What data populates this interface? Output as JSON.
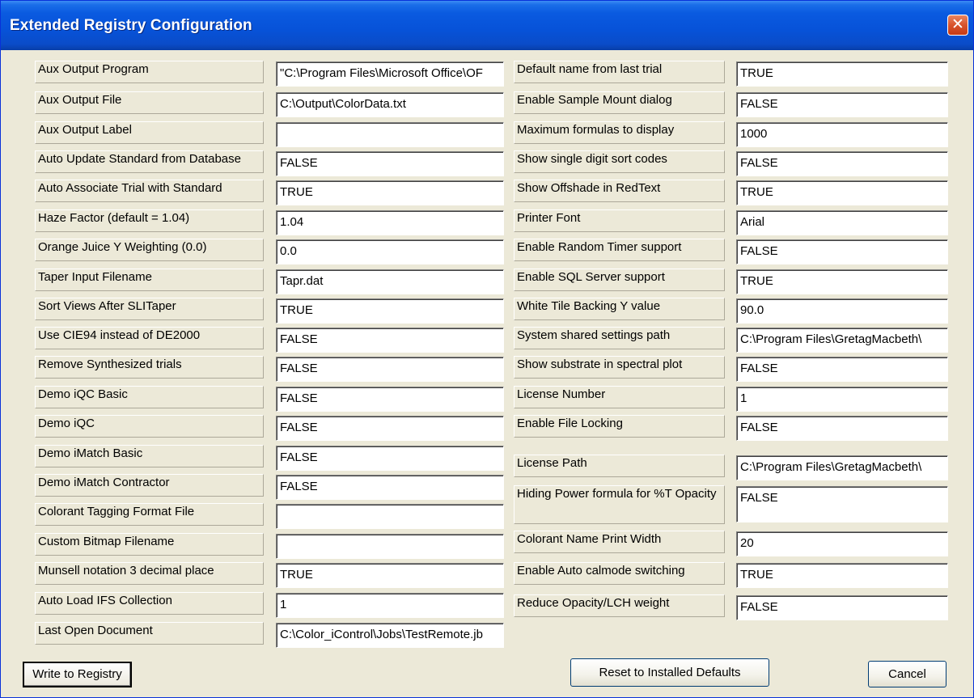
{
  "window": {
    "title": "Extended Registry Configuration",
    "close_glyph": "✕"
  },
  "left": [
    {
      "label": "Aux Output Program",
      "value": "\"C:\\Program Files\\Microsoft Office\\OF"
    },
    {
      "label": "Aux Output File",
      "value": "C:\\Output\\ColorData.txt"
    },
    {
      "label": "Aux Output Label",
      "value": ""
    },
    {
      "label": "Auto Update Standard from Database",
      "value": "FALSE"
    },
    {
      "label": "Auto Associate Trial with Standard",
      "value": "TRUE"
    },
    {
      "label": "Haze Factor (default = 1.04)",
      "value": "1.04"
    },
    {
      "label": "Orange Juice Y Weighting (0.0)",
      "value": "0.0"
    },
    {
      "label": "Taper Input Filename",
      "value": "Tapr.dat"
    },
    {
      "label": "Sort Views After SLITaper",
      "value": "TRUE"
    },
    {
      "label": "Use CIE94 instead of DE2000",
      "value": "FALSE"
    },
    {
      "label": "Remove Synthesized trials",
      "value": "FALSE"
    },
    {
      "label": "Demo iQC Basic",
      "value": "FALSE"
    },
    {
      "label": "Demo iQC",
      "value": "FALSE"
    },
    {
      "label": "Demo iMatch Basic",
      "value": "FALSE"
    },
    {
      "label": "Demo iMatch Contractor",
      "value": "FALSE"
    },
    {
      "label": "Colorant Tagging Format File",
      "value": ""
    },
    {
      "label": "Custom Bitmap Filename",
      "value": ""
    },
    {
      "label": "Munsell notation 3 decimal place",
      "value": "TRUE"
    },
    {
      "label": "Auto Load IFS Collection",
      "value": "1"
    },
    {
      "label": "Last Open Document",
      "value": "C:\\Color_iControl\\Jobs\\TestRemote.jb"
    }
  ],
  "right": [
    {
      "label": "Default name from last trial",
      "value": "TRUE"
    },
    {
      "label": "Enable Sample Mount dialog",
      "value": "FALSE"
    },
    {
      "label": "Maximum formulas to display",
      "value": "1000"
    },
    {
      "label": "Show single digit sort codes",
      "value": "FALSE"
    },
    {
      "label": "Show Offshade in RedText",
      "value": "TRUE"
    },
    {
      "label": "Printer Font",
      "value": "Arial"
    },
    {
      "label": "Enable Random Timer support",
      "value": "FALSE"
    },
    {
      "label": "Enable SQL Server support",
      "value": "TRUE"
    },
    {
      "label": "White Tile Backing Y value",
      "value": "90.0"
    },
    {
      "label": "System shared settings path",
      "value": "C:\\Program Files\\GretagMacbeth\\"
    },
    {
      "label": "Show substrate in spectral plot",
      "value": "FALSE"
    },
    {
      "label": "License Number",
      "value": "1"
    },
    {
      "label": "Enable File Locking",
      "value": "FALSE"
    },
    {
      "label": "License Path",
      "value": "C:\\Program Files\\GretagMacbeth\\"
    },
    {
      "label": "Hiding Power formula for %T Opacity",
      "value": "FALSE"
    },
    {
      "label": "Colorant Name Print Width",
      "value": "20"
    },
    {
      "label": "Enable Auto calmode switching",
      "value": "TRUE"
    },
    {
      "label": "Reduce Opacity/LCH  weight",
      "value": "FALSE"
    }
  ],
  "buttons": {
    "write": "Write to Registry",
    "reset": "Reset to Installed Defaults",
    "cancel": "Cancel"
  }
}
